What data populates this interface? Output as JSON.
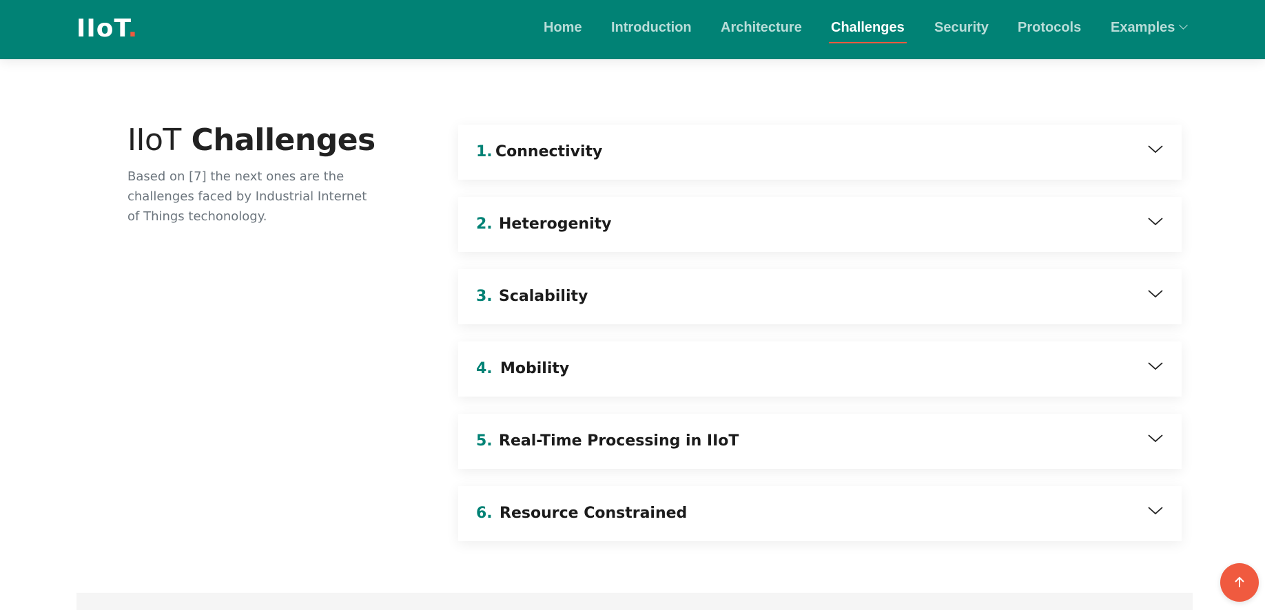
{
  "header": {
    "logo_text": "IIoT",
    "logo_dot": ".",
    "nav": [
      {
        "label": "Home"
      },
      {
        "label": "Introduction"
      },
      {
        "label": "Architecture"
      },
      {
        "label": "Challenges",
        "active": true
      },
      {
        "label": "Security"
      },
      {
        "label": "Protocols"
      },
      {
        "label": "Examples",
        "dropdown": true
      }
    ],
    "colors": {
      "background": "#018275",
      "accent": "#f05a3f"
    }
  },
  "section": {
    "title_light": "IIoT",
    "title_bold": "Challenges",
    "description": "Based on [7] the next ones are the challenges faced by Industrial Internet of Things techonology."
  },
  "accordion": {
    "items": [
      {
        "number": "1.",
        "label": "Connectivity",
        "icon": "chevron-down-icon"
      },
      {
        "number": "2.",
        "label": "Heterogenity",
        "icon": "chevron-down-icon"
      },
      {
        "number": "3.",
        "label": "Scalability",
        "icon": "chevron-down-icon"
      },
      {
        "number": "4.",
        "label": "Mobility",
        "icon": "chevron-down-icon"
      },
      {
        "number": "5.",
        "label": "Real-Time Processing in IIoT",
        "icon": "chevron-down-icon"
      },
      {
        "number": "6.",
        "label": "Resource Constrained",
        "icon": "chevron-down-icon"
      }
    ]
  },
  "back_to_top": {
    "icon": "arrow-up-icon"
  }
}
